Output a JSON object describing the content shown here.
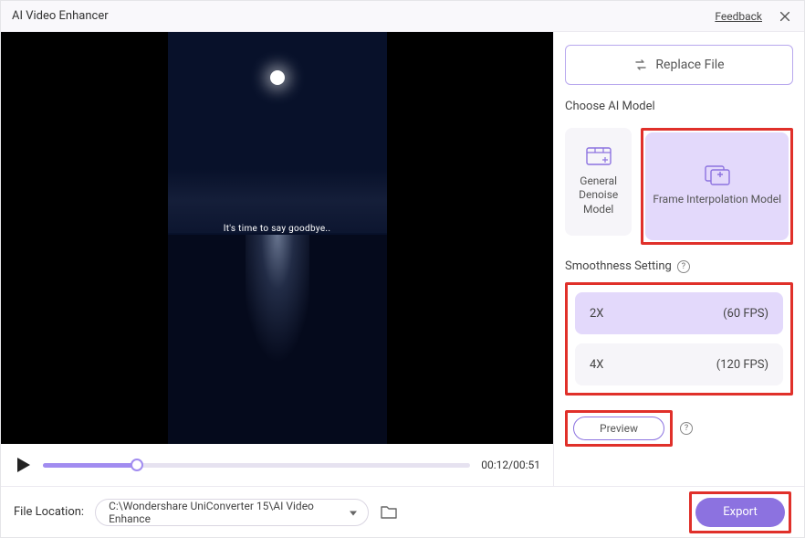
{
  "window": {
    "title": "AI Video Enhancer",
    "feedback": "Feedback"
  },
  "video": {
    "caption": "It's time to say goodbye..",
    "elapsed": "00:12",
    "duration": "00:51",
    "time_display": "00:12/00:51"
  },
  "replace": {
    "label": "Replace File"
  },
  "models": {
    "section_label": "Choose AI Model",
    "general": {
      "label": "General Denoise Model"
    },
    "frame": {
      "label": "Frame Interpolation Model"
    },
    "selected": "frame"
  },
  "smoothness": {
    "section_label": "Smoothness Setting",
    "options": [
      {
        "multiplier": "2X",
        "fps": "(60 FPS)",
        "selected": true
      },
      {
        "multiplier": "4X",
        "fps": "(120 FPS)",
        "selected": false
      }
    ]
  },
  "preview": {
    "label": "Preview"
  },
  "footer": {
    "location_label": "File Location:",
    "location_value": "C:\\Wondershare UniConverter 15\\AI Video Enhance"
  },
  "export": {
    "label": "Export"
  },
  "colors": {
    "accent": "#8c72e0",
    "highlight": "#e0302a"
  }
}
